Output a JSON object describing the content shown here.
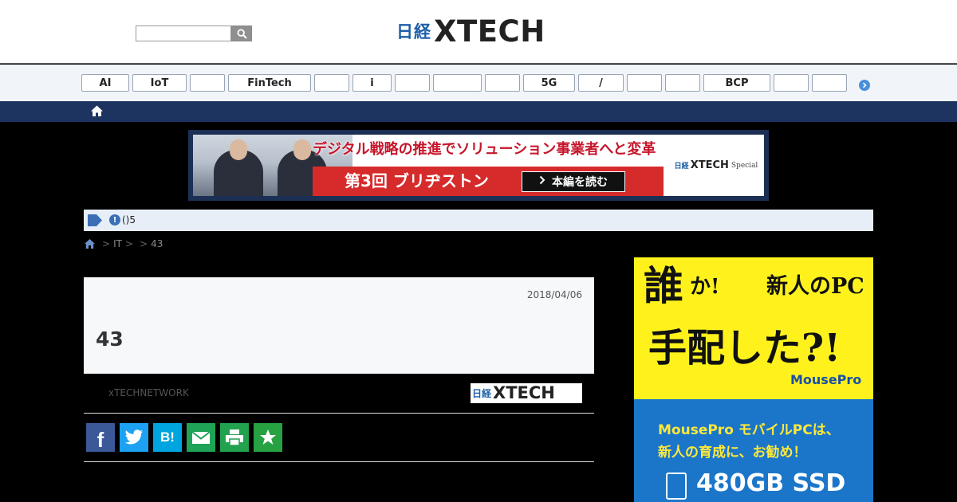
{
  "header": {
    "search_placeholder": "",
    "logo_nikkei": "日経",
    "logo_xtech": "XTECH"
  },
  "tags": [
    "AI",
    "IoT",
    "",
    "FinTech",
    "",
    "i",
    "",
    "",
    "",
    "5G",
    "/",
    "",
    "",
    "BCP",
    "",
    ""
  ],
  "banner": {
    "headline": "デジタル戦略の推進でソリューション事業者へと変革",
    "red_text": "第3回 ブリヂストン",
    "cta": "本編を読む",
    "brand_nikkei": "日経",
    "brand_xtech": "XTECH",
    "brand_special": "Special"
  },
  "notice": {
    "alert_glyph": "!",
    "text": "()5"
  },
  "breadcrumb": {
    "items": [
      "IT",
      "",
      "43"
    ],
    "separator": ">"
  },
  "article": {
    "date": "2018/04/06",
    "title": "43",
    "byline": "xTECHNETWORK",
    "logo_nikkei": "日経",
    "logo_xtech": "XTECH"
  },
  "share": {
    "icons": [
      "facebook-icon",
      "twitter-icon",
      "hatena-bookmark-icon",
      "mail-icon",
      "print-icon",
      "favorite-star-icon"
    ],
    "hatena_label": "B!",
    "facebook_label": "f"
  },
  "side_ad": {
    "line1a": "誰",
    "line1b": "か!",
    "line1c": "新人のPC",
    "line2": "手配した?!",
    "brand": "MousePro",
    "sub1": "MousePro モバイルPCは、",
    "sub2": "新人の育成に、お勧め！",
    "ssd": "480GB SSD"
  },
  "colors": {
    "page_bg": "#000000",
    "nav_bar": "#1d3461",
    "notice_bg": "#e7eef8",
    "accent_blue": "#1d5fa8",
    "ad_yellow": "#fff21c",
    "ad_blue": "#1b76c9"
  }
}
